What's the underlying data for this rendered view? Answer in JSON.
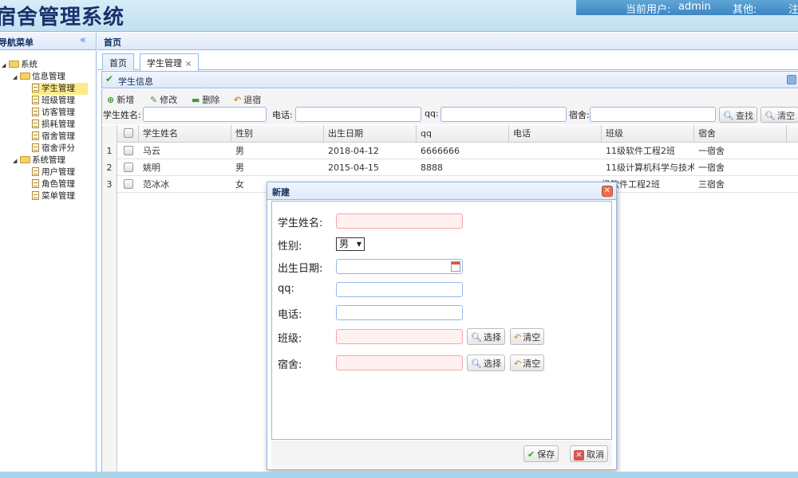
{
  "header": {
    "app_title": "宿舍管理系统",
    "current_user_label": "当前用户:",
    "current_user": "admin",
    "other_label": "其他:",
    "logout_partial": "注"
  },
  "sidebar": {
    "title": "导航菜单",
    "collapse_icon": "double-chevron-left-icon",
    "tree": {
      "root": "系统",
      "groups": [
        {
          "label": "信息管理",
          "items": [
            "学生管理",
            "班级管理",
            "访客管理",
            "损耗管理",
            "宿舍管理",
            "宿舍评分"
          ],
          "selected": "学生管理"
        },
        {
          "label": "系统管理",
          "items": [
            "用户管理",
            "角色管理",
            "菜单管理"
          ]
        }
      ]
    }
  },
  "main": {
    "title": "首页",
    "tabs": [
      {
        "label": "首页",
        "active": false
      },
      {
        "label": "学生管理",
        "active": true,
        "closable": true
      }
    ],
    "panel_title": "学生信息",
    "toolbar": {
      "buttons": [
        "新增",
        "修改",
        "删除",
        "退宿"
      ],
      "search": {
        "name_label": "学生姓名:",
        "phone_label": "电话:",
        "qq_label": "qq:",
        "dorm_label": "宿舍:",
        "find_button": "查找",
        "clear_button": "清空"
      }
    },
    "grid": {
      "columns": [
        "学生姓名",
        "性别",
        "出生日期",
        "qq",
        "电话",
        "班级",
        "宿舍"
      ],
      "rows": [
        {
          "num": "1",
          "name": "马云",
          "gender": "男",
          "birth": "2018-04-12",
          "qq": "6666666",
          "phone": "",
          "class": "11级软件工程2班",
          "dorm": "一宿舍"
        },
        {
          "num": "2",
          "name": "姚明",
          "gender": "男",
          "birth": "2015-04-15",
          "qq": "8888",
          "phone": "",
          "class": "11级计算机科学与技术",
          "dorm": "一宿舍"
        },
        {
          "num": "3",
          "name": "范冰冰",
          "gender": "女",
          "birth": "",
          "qq": "",
          "phone": "",
          "class": "级软件工程2班",
          "dorm": "三宿舍"
        }
      ]
    }
  },
  "dialog": {
    "title": "新建",
    "fields": {
      "name_label": "学生姓名:",
      "gender_label": "性别:",
      "gender_value": "男",
      "birth_label": "出生日期:",
      "qq_label": "qq:",
      "phone_label": "电话:",
      "class_label": "班级:",
      "dorm_label": "宿舍:"
    },
    "select_button": "选择",
    "clear_button": "清空",
    "save_button": "保存",
    "cancel_button": "取消"
  },
  "colors": {
    "border": "#95b8e7",
    "header_bg": "#c2e0f1",
    "title_color": "#1b2f6b",
    "selected_node": "#fbec88",
    "required_field": "#fff1f1"
  }
}
